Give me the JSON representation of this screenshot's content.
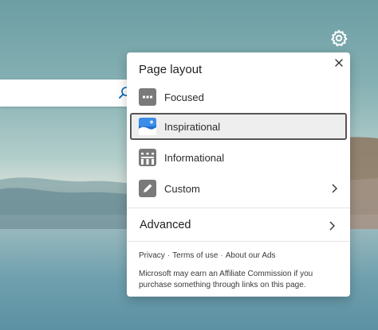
{
  "panel": {
    "title": "Page layout",
    "options": [
      {
        "label": "Focused",
        "icon": "focused-layout-icon",
        "selected": false
      },
      {
        "label": "Inspirational",
        "icon": "inspirational-layout-icon",
        "selected": true
      },
      {
        "label": "Informational",
        "icon": "informational-layout-icon",
        "selected": false
      },
      {
        "label": "Custom",
        "icon": "pencil-icon",
        "selected": false
      }
    ],
    "advanced_label": "Advanced",
    "footer": {
      "privacy": "Privacy",
      "terms": "Terms of use",
      "about_ads": "About our Ads",
      "separator": "·",
      "disclaimer": "Microsoft may earn an Affiliate Commission if you purchase something through links on this page."
    }
  },
  "colors": {
    "accent": "#0067b8",
    "selected_bg": "#eeeeee",
    "selected_border": "#555555",
    "icon_gray": "#7a7a7a"
  }
}
